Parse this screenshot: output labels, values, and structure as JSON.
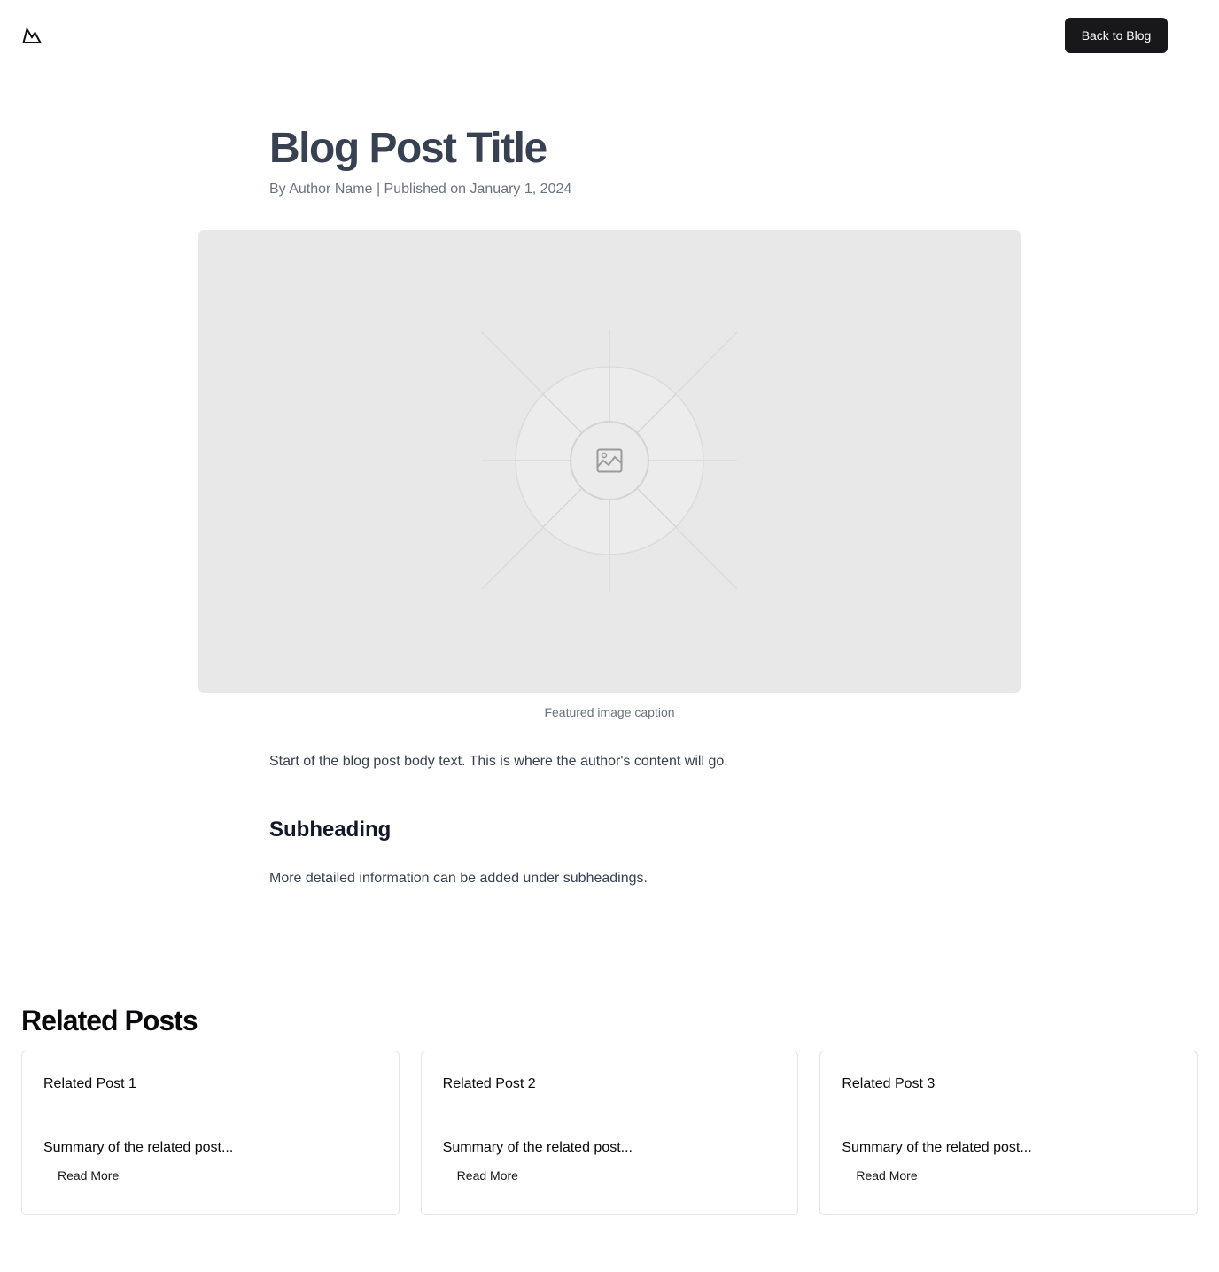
{
  "header": {
    "logo_icon": "mountain-logo-icon",
    "back_label": "Back to Blog"
  },
  "post": {
    "title": "Blog Post Title",
    "meta": "By Author Name | Published on January 1, 2024",
    "image_icon": "image-placeholder-icon",
    "caption": "Featured image caption",
    "intro": "Start of the blog post body text. This is where the author's content will go.",
    "subheading": "Subheading",
    "detail": "More detailed information can be added under subheadings."
  },
  "related": {
    "heading": "Related Posts",
    "items": [
      {
        "title": "Related Post 1",
        "summary": "Summary of the related post...",
        "link": "Read More"
      },
      {
        "title": "Related Post 2",
        "summary": "Summary of the related post...",
        "link": "Read More"
      },
      {
        "title": "Related Post 3",
        "summary": "Summary of the related post...",
        "link": "Read More"
      }
    ]
  },
  "colors": {
    "button_bg": "#18181b",
    "title": "#374151",
    "muted": "#6b7280",
    "placeholder_bg": "#e8e8e8",
    "card_border": "#e4e4e7"
  }
}
